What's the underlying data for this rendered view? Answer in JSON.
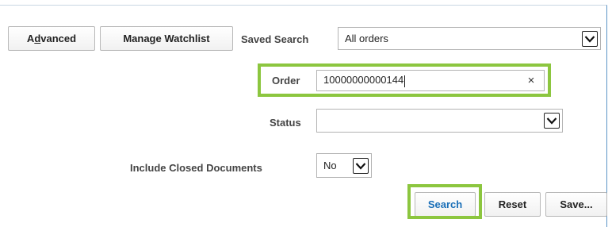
{
  "toolbar": {
    "advanced_label": "Advanced",
    "manage_watchlist_label": "Manage Watchlist",
    "saved_search_label": "Saved Search",
    "saved_search_value": "All orders"
  },
  "form": {
    "order_label": "Order",
    "order_value": "10000000000144",
    "clear_symbol": "×",
    "status_label": "Status",
    "status_value": "",
    "include_closed_label": "Include Closed Documents",
    "include_closed_value": "No"
  },
  "actions": {
    "search_label": "Search",
    "reset_label": "Reset",
    "save_label": "Save..."
  },
  "colors": {
    "highlight": "#8cc63f",
    "search_text": "#1a6fb8",
    "panel_border": "#5b94c6"
  }
}
